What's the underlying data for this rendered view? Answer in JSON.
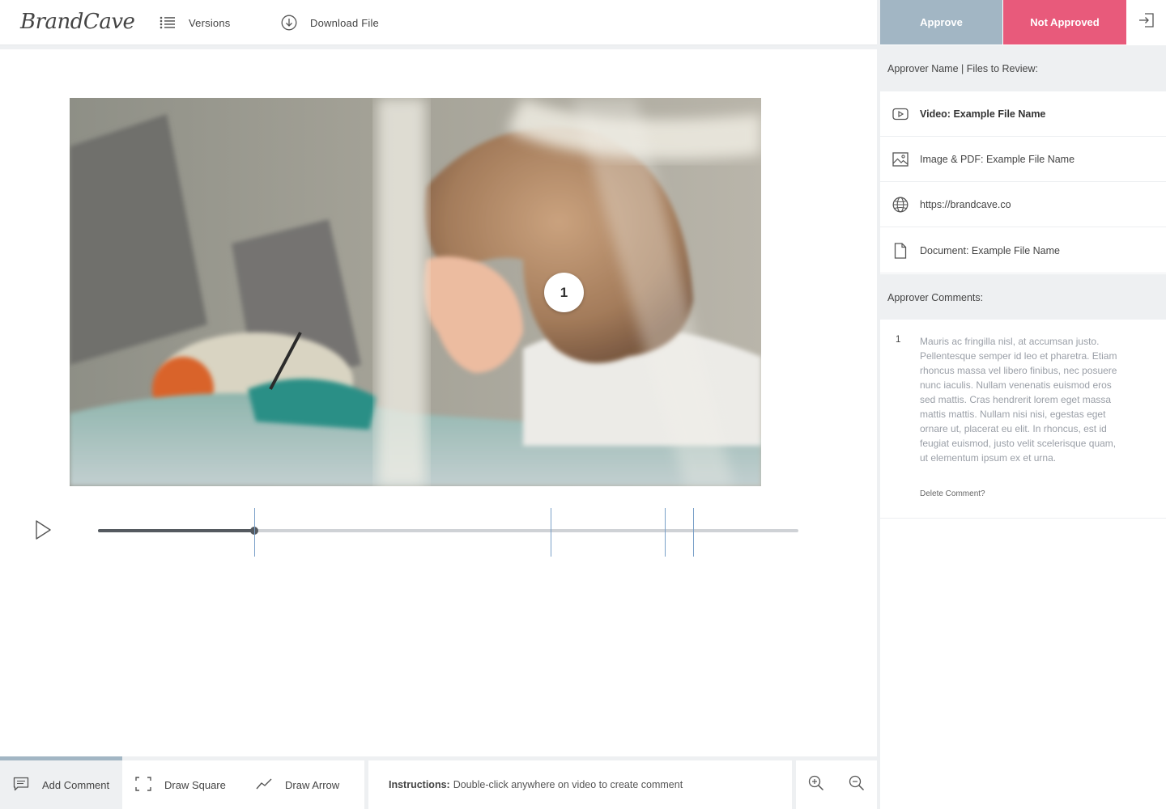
{
  "header": {
    "logo_text": "BrandCave",
    "versions_label": "Versions",
    "download_label": "Download File"
  },
  "approval": {
    "approve_label": "Approve",
    "not_approved_label": "Not Approved",
    "approve_color": "#a2b6c4",
    "not_approved_color": "#e85a7b"
  },
  "files_panel": {
    "header": "Approver Name | Files to Review:",
    "items": [
      {
        "icon": "video-play-icon",
        "label": "Video: Example File Name",
        "active": true
      },
      {
        "icon": "image-icon",
        "label": "Image & PDF: Example File Name",
        "active": false
      },
      {
        "icon": "globe-icon",
        "label": "https://brandcave.co",
        "active": false
      },
      {
        "icon": "document-icon",
        "label": "Document: Example File Name",
        "active": false
      }
    ]
  },
  "comments_panel": {
    "header": "Approver Comments:",
    "comments": [
      {
        "number": "1",
        "text": "Mauris ac fringilla nisl, at accumsan justo. Pellentesque semper id leo et pharetra. Etiam rhoncus massa vel libero finibus, nec posuere nunc iaculis. Nullam venenatis euismod eros sed mattis. Cras hendrerit lorem eget massa mattis mattis. Nullam nisi nisi, egestas eget ornare ut, placerat eu elit. In rhoncus, est id feugiat euismod, justo velit scelerisque quam, ut elementum ipsum ex et urna.",
        "delete_label": "Delete Comment?"
      }
    ]
  },
  "player": {
    "marker_number": "1",
    "progress": 0.223,
    "comment_markers": [
      0.223,
      0.646,
      0.809,
      0.85
    ]
  },
  "toolbar": {
    "add_comment_label": "Add Comment",
    "draw_square_label": "Draw Square",
    "draw_arrow_label": "Draw Arrow",
    "instructions_title": "Instructions:",
    "instructions_text": "Double-click anywhere on video to create comment"
  }
}
